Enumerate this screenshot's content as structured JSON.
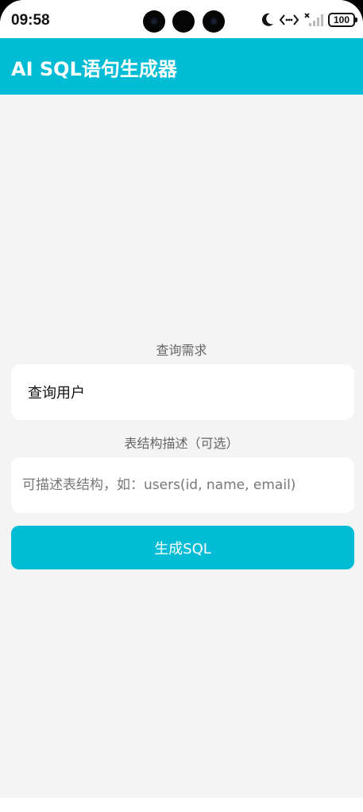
{
  "status_bar": {
    "time": "09:58",
    "icons": [
      "moon-icon",
      "data-transfer-icon",
      "no-signal-icon",
      "battery-icon"
    ],
    "battery_level": "100"
  },
  "app_bar": {
    "title": "AI SQL语句生成器",
    "color": "#00bcd4"
  },
  "form": {
    "query_label": "查询需求",
    "query_value": "查询用户",
    "schema_label": "表结构描述（可选）",
    "schema_placeholder": "可描述表结构，如：users(id, name, email)",
    "submit_label": "生成SQL"
  }
}
